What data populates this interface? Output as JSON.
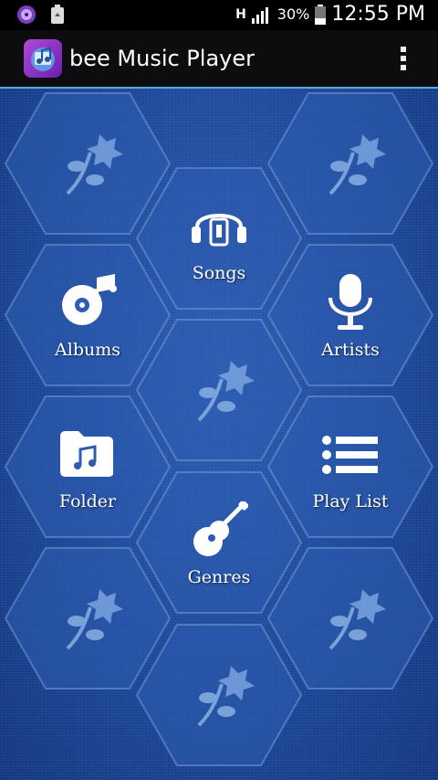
{
  "status_bar": {
    "network_type": "H",
    "battery_percent": "30%",
    "time": "12:55 PM",
    "left_icons": [
      "music-notification-icon",
      "recycle-icon"
    ]
  },
  "app_bar": {
    "title": "bee Music Player",
    "menu_icon": "overflow-menu-icon"
  },
  "tiles": [
    {
      "label": "Songs",
      "icon": "headphones-icon"
    },
    {
      "label": "Albums",
      "icon": "disc-icon"
    },
    {
      "label": "Artists",
      "icon": "microphone-icon"
    },
    {
      "label": "Folder",
      "icon": "folder-icon"
    },
    {
      "label": "Play List",
      "icon": "list-icon"
    },
    {
      "label": "Genres",
      "icon": "guitar-icon"
    }
  ],
  "colors": {
    "background": "#1f4a9c",
    "app_bar": "#0d0d0f",
    "accent_line": "#58a9dd",
    "hex_fill": "#2d5cb0",
    "text": "#ffffff"
  }
}
